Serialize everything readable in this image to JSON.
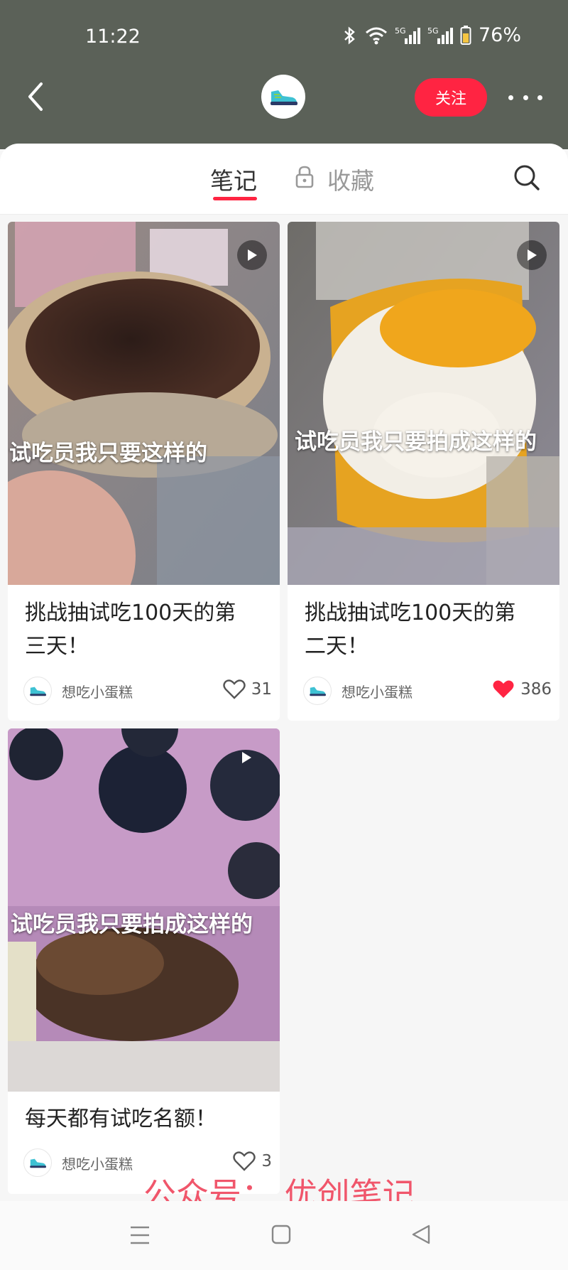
{
  "status_bar": {
    "time": "11:22",
    "battery": "76%",
    "signal_1": "5G",
    "signal_2": "5G"
  },
  "header": {
    "follow_label": "关注",
    "back_icon": "chevron-left-icon",
    "more_icon": "more-dots-icon"
  },
  "tabs": {
    "notes": "笔记",
    "favorites": "收藏"
  },
  "notes": [
    {
      "overlay": "试吃员我只要这样的",
      "title_line1": "挑战抽试吃100天的第",
      "title_line2": "三天！",
      "author": "想吃小蛋糕",
      "likes": "31",
      "liked": false
    },
    {
      "overlay": "试吃员我只要拍成这样的",
      "title_line1": "挑战抽试吃100天的第",
      "title_line2": "二天！",
      "author": "想吃小蛋糕",
      "likes": "386",
      "liked": true
    },
    {
      "overlay": "试吃员我只要拍成这样的",
      "title_line1": "每天都有试吃名额！",
      "author": "想吃小蛋糕",
      "likes": "3",
      "liked": false
    }
  ],
  "watermark": "公众号：  优创笔记",
  "colors": {
    "accent": "#ff2442",
    "header_bg": "#5b6158"
  }
}
